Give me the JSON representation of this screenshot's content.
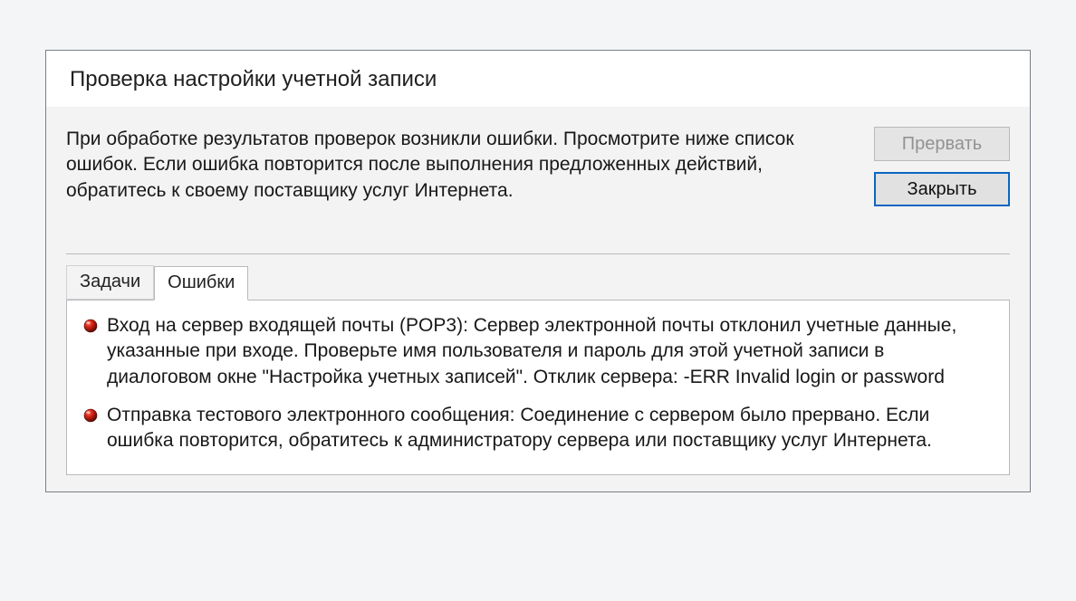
{
  "dialog": {
    "title": "Проверка настройки учетной записи",
    "description": "При обработке результатов проверок возникли ошибки. Просмотрите ниже список ошибок. Если ошибка повторится после выполнения предложенных действий, обратитесь к своему поставщику услуг Интернета.",
    "buttons": {
      "abort": "Прервать",
      "close": "Закрыть"
    },
    "tabs": {
      "tasks": "Задачи",
      "errors": "Ошибки"
    },
    "errors": [
      {
        "text": "Вход на сервер входящей почты (POP3): Сервер электронной почты отклонил учетные данные, указанные при входе. Проверьте имя пользователя и пароль для этой учетной записи в диалоговом окне \"Настройка учетных записей\".  Отклик сервера: -ERR Invalid login or password"
      },
      {
        "text": "Отправка тестового электронного сообщения: Соединение с сервером было прервано. Если ошибка повторится, обратитесь к администратору сервера или поставщику услуг Интернета."
      }
    ]
  }
}
